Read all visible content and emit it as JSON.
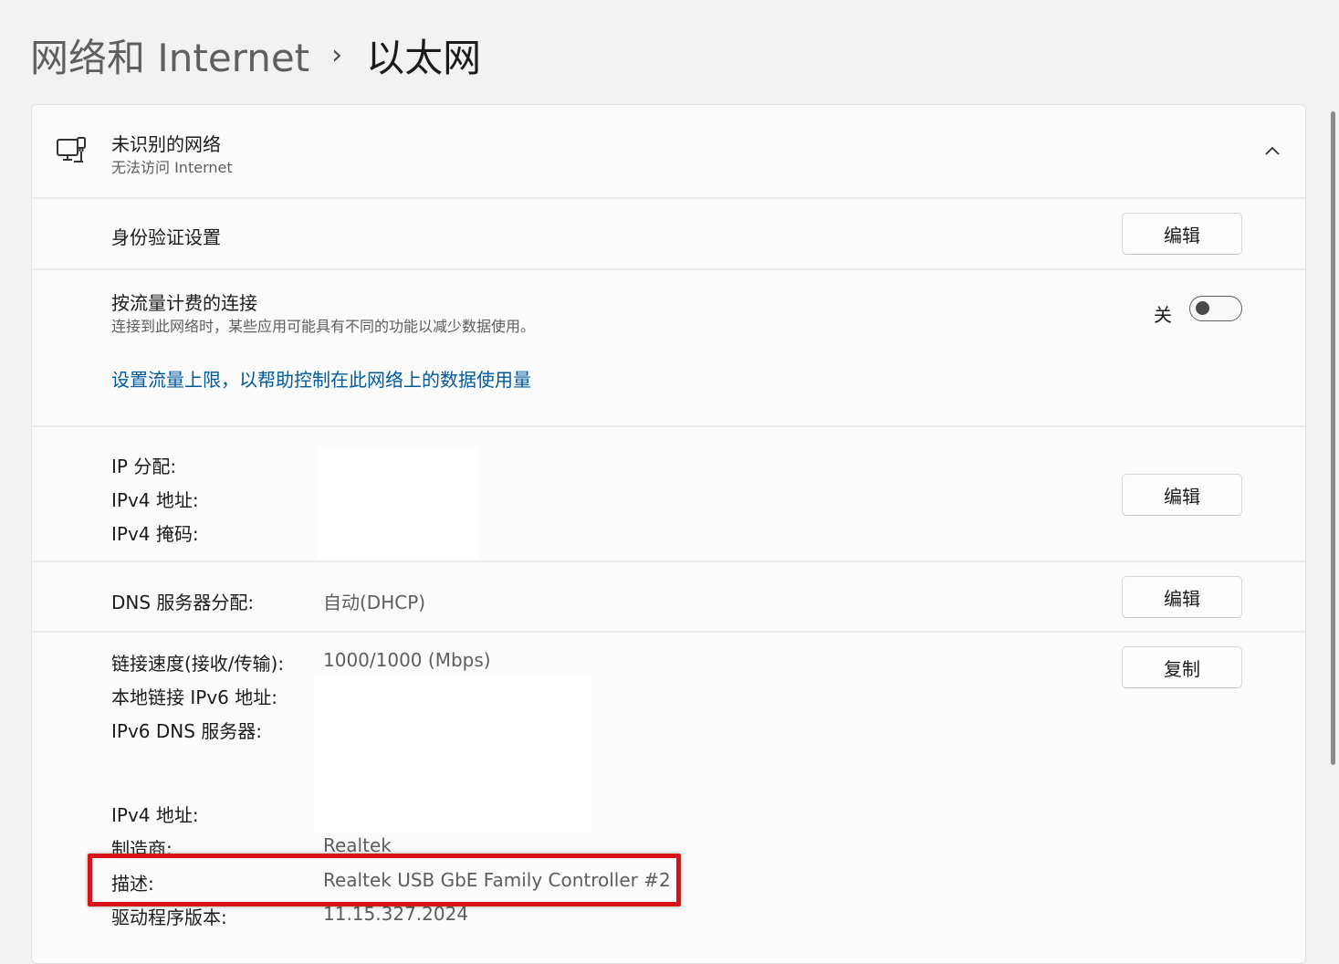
{
  "breadcrumb": {
    "parent": "网络和 Internet",
    "separator": "›",
    "current": "以太网"
  },
  "network": {
    "name": "未识别的网络",
    "status": "无法访问 Internet",
    "icon": "ethernet-network-icon",
    "collapse_icon": "chevron-up-icon"
  },
  "auth": {
    "label": "身份验证设置",
    "button": "编辑"
  },
  "metered": {
    "label": "按流量计费的连接",
    "description": "连接到此网络时，某些应用可能具有不同的功能以减少数据使用。",
    "toggle_state": "关",
    "toggle_on": false,
    "link": "设置流量上限，以帮助控制在此网络上的数据使用量"
  },
  "ip": {
    "assignment_label": "IP 分配:",
    "ipv4_address_label": "IPv4 地址:",
    "ipv4_mask_label": "IPv4 掩码:",
    "button": "编辑"
  },
  "dns": {
    "label": "DNS 服务器分配:",
    "value": "自动(DHCP)",
    "button": "编辑"
  },
  "properties": {
    "button": "复制",
    "link_speed_label": "链接速度(接收/传输):",
    "link_speed_value": "1000/1000 (Mbps)",
    "ipv6_local_label": "本地链接 IPv6 地址:",
    "ipv6_dns_label": "IPv6 DNS 服务器:",
    "ipv4_address_label": "IPv4 地址:",
    "manufacturer_label": "制造商:",
    "manufacturer_value": "Realtek",
    "description_label": "描述:",
    "description_value": "Realtek USB GbE Family Controller #2",
    "driver_label": "驱动程序版本:",
    "driver_value": "11.15.327.2024"
  },
  "colors": {
    "accent_link": "#005a9e",
    "highlight": "#d7141a",
    "background": "#f3f2f2",
    "card": "#fbfbfb"
  }
}
